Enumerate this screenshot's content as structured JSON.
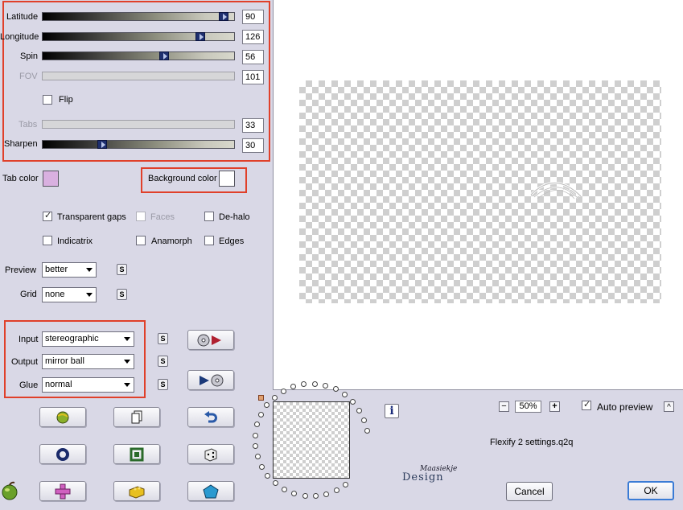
{
  "sliders": {
    "latitude": {
      "label": "Latitude",
      "value": "90",
      "level": 0.97
    },
    "longitude": {
      "label": "Longitude",
      "value": "126",
      "level": 0.84
    },
    "spin": {
      "label": "Spin",
      "value": "56",
      "level": 0.64
    },
    "fov": {
      "label": "FOV",
      "value": "101"
    },
    "tabs": {
      "label": "Tabs",
      "value": "33"
    },
    "sharpen": {
      "label": "Sharpen",
      "value": "30",
      "level": 0.3
    }
  },
  "flip": {
    "label": "Flip",
    "checked": false
  },
  "colors": {
    "tab_color_label": "Tab color",
    "tab_color": "#d9b0e0",
    "background_color_label": "Background color",
    "background_color": "#ffffff",
    "highlight": "#e0402a"
  },
  "options": {
    "transparent_gaps": {
      "label": "Transparent gaps",
      "checked": true
    },
    "faces": {
      "label": "Faces",
      "checked": false
    },
    "dehalo": {
      "label": "De-halo",
      "checked": false
    },
    "indicatrix": {
      "label": "Indicatrix",
      "checked": false
    },
    "anamorph": {
      "label": "Anamorph",
      "checked": false
    },
    "edges": {
      "label": "Edges",
      "checked": false
    }
  },
  "preview": {
    "label": "Preview",
    "value": "better"
  },
  "grid": {
    "label": "Grid",
    "value": "none"
  },
  "mapping": {
    "input": {
      "label": "Input",
      "value": "stereographic"
    },
    "output": {
      "label": "Output",
      "value": "mirror ball"
    },
    "glue": {
      "label": "Glue",
      "value": "normal"
    }
  },
  "s_label": "S",
  "zoom": {
    "value": "50%",
    "minus": "−",
    "plus": "+"
  },
  "auto_preview": {
    "label": "Auto preview",
    "checked": true
  },
  "settings_file": "Flexify 2 settings.q2q",
  "watermark": "Design",
  "watermark_script": "Maasiekje",
  "cancel_label": "Cancel",
  "ok_label": "OK",
  "info_label": "i",
  "collapse_label": "^"
}
